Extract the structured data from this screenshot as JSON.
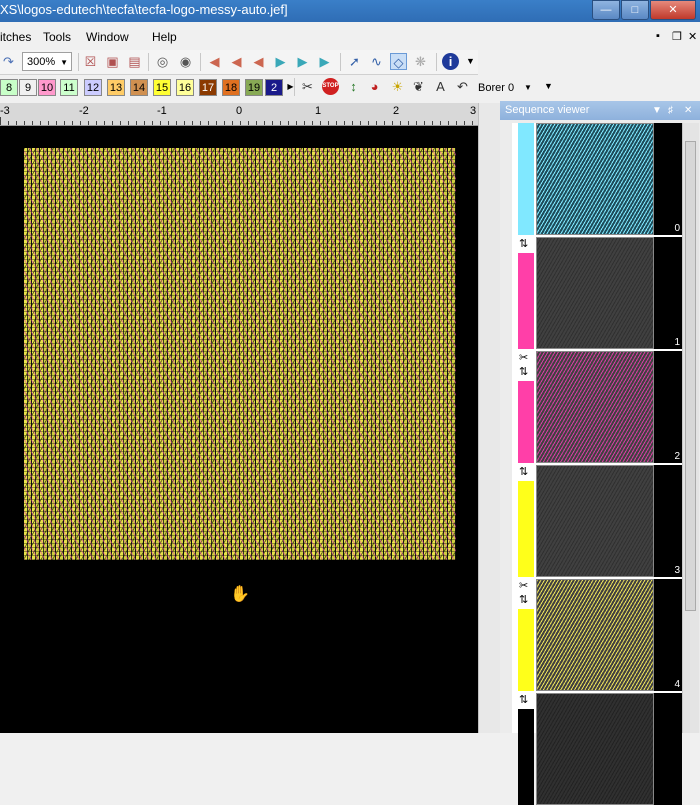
{
  "title": "XS\\logos-edutech\\tecfa\\tecfa-logo-messy-auto.jef]",
  "menu": [
    "itches",
    "Tools",
    "Window",
    "Help"
  ],
  "toolbar": {
    "zoom": "300%"
  },
  "colors": {
    "chips": [
      {
        "label": "8",
        "bg": "#c8ffc8"
      },
      {
        "label": "9",
        "bg": "#f0f0f0"
      },
      {
        "label": "10",
        "bg": "#ff99cc"
      },
      {
        "label": "11",
        "bg": "#ccffcc"
      },
      {
        "label": "12",
        "bg": "#ccccff"
      },
      {
        "label": "13",
        "bg": "#ffcc66"
      },
      {
        "label": "14",
        "bg": "#d09050"
      },
      {
        "label": "15",
        "bg": "#ffff33"
      },
      {
        "label": "16",
        "bg": "#ffff99"
      },
      {
        "label": "17",
        "bg": "#8b3a00"
      },
      {
        "label": "18",
        "bg": "#e07020"
      },
      {
        "label": "19",
        "bg": "#88aa55"
      },
      {
        "label": "2",
        "bg": "#1a1a8a"
      }
    ]
  },
  "borer": "Borer 0",
  "ruler": {
    "labels": [
      "-3",
      "-2",
      "-1",
      "0",
      "1",
      "2",
      "3"
    ]
  },
  "sequence_viewer": {
    "title": "Sequence viewer",
    "items": [
      {
        "num": "0",
        "color": "#80e8ff",
        "thumb": "#1e4c5a",
        "stitch": "#7fe8ff",
        "cut": false,
        "lock": false
      },
      {
        "num": "1",
        "color": "#ff3fa8",
        "thumb": "#404040",
        "stitch": "#303030",
        "cut": false,
        "lock": true
      },
      {
        "num": "2",
        "color": "#ff3fa8",
        "thumb": "#404040",
        "stitch": "#d33ea1",
        "cut": true,
        "lock": true
      },
      {
        "num": "3",
        "color": "#ffff1a",
        "thumb": "#404040",
        "stitch": "#303030",
        "cut": false,
        "lock": true
      },
      {
        "num": "4",
        "color": "#ffff1a",
        "thumb": "#404040",
        "stitch": "#e9e05a",
        "cut": true,
        "lock": true
      },
      {
        "num": "",
        "color": "#000000",
        "thumb": "#303030",
        "stitch": "#222222",
        "cut": false,
        "lock": true
      }
    ]
  }
}
